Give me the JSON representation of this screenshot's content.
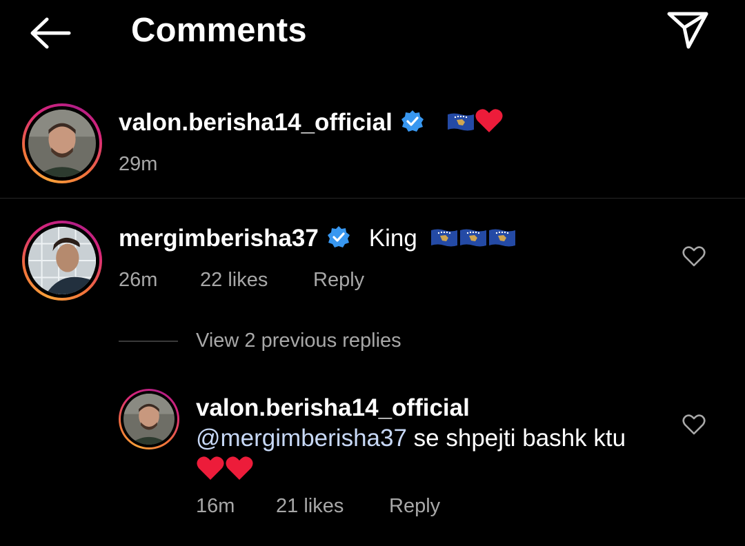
{
  "header": {
    "title": "Comments",
    "back_icon": "arrow-left-icon",
    "send_icon": "paper-plane-icon"
  },
  "caption": {
    "username": "valon.berisha14_official",
    "text_emojis": "🇽🇰❤️",
    "time": "29m"
  },
  "comment": {
    "username": "mergimberisha37",
    "text": "King",
    "emojis": "🇽🇰🇽🇰🇽🇰",
    "time": "26m",
    "likes": "22 likes",
    "reply_label": "Reply"
  },
  "view_replies": "View 2 previous replies",
  "reply": {
    "username": "valon.berisha14_official",
    "mention": "@mergimberisha37",
    "text": " se shpejti bashk ktu",
    "emojis": "❤️❤️",
    "time": "16m",
    "likes": "21 likes",
    "reply_label": "Reply"
  },
  "colors": {
    "background": "#000000",
    "verified": "#3897f0",
    "meta_text": "#a8a8a8",
    "heart": "#ed1c3a"
  }
}
